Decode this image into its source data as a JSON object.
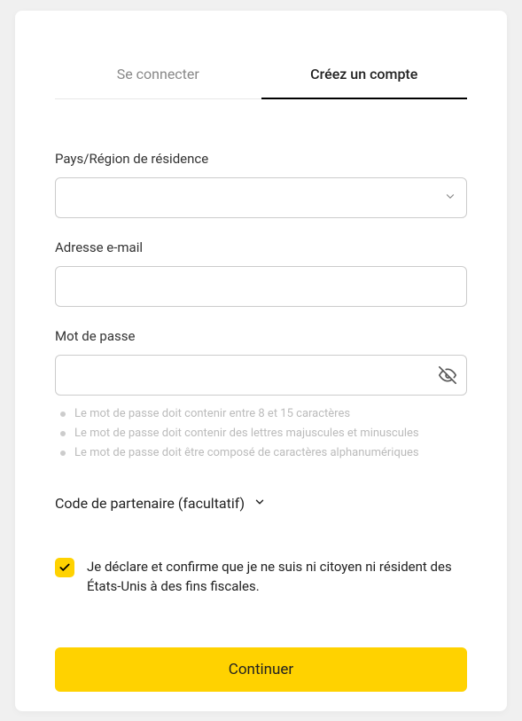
{
  "tabs": {
    "login": "Se connecter",
    "register": "Créez un compte"
  },
  "fields": {
    "country": {
      "label": "Pays/Région de résidence",
      "value": ""
    },
    "email": {
      "label": "Adresse e-mail",
      "value": ""
    },
    "password": {
      "label": "Mot de passe",
      "value": ""
    }
  },
  "password_rules": [
    "Le mot de passe doit contenir entre 8 et 15 caractères",
    "Le mot de passe doit contenir des lettres majuscules et minuscules",
    "Le mot de passe doit être composé de caractères alphanumériques"
  ],
  "partner": {
    "label": "Code de partenaire (facultatif)"
  },
  "consent": {
    "checked": true,
    "text": "Je déclare et confirme que je ne suis ni citoyen ni résident des États-Unis à des fins fiscales."
  },
  "continue_label": "Continuer"
}
